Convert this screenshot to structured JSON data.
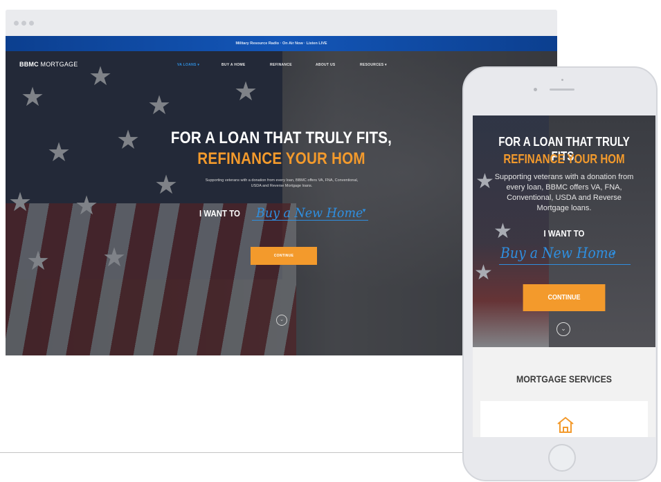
{
  "desktop": {
    "alert_bar": "Military Resource Radio · On Air Now · Listen LIVE",
    "logo": {
      "brand": "BBMC",
      "suffix": "MORTGAGE"
    },
    "nav": [
      {
        "label": "VA LOANS ▾",
        "active": true
      },
      {
        "label": "BUY A HOME",
        "active": false
      },
      {
        "label": "REFINANCE",
        "active": false
      },
      {
        "label": "ABOUT US",
        "active": false
      },
      {
        "label": "RESOURCES ▾",
        "active": false
      }
    ],
    "hero": {
      "title_line1": "FOR A LOAN THAT TRULY FITS,",
      "title_line2": "REFINANCE YOUR HOM",
      "subtitle": "Supporting veterans with a donation from every loan, BBMC offers VA, FNA, Conventional, USDA and Reverse Mortgage loans.",
      "want_label": "I WANT TO",
      "select_value": "Buy a New Home",
      "continue_label": "CONTINUE"
    }
  },
  "mobile": {
    "title_line1": "FOR A LOAN THAT TRULY FITS,",
    "title_line2": "REFINANCE YOUR HOM",
    "subtitle": "Supporting veterans with a donation from every loan, BBMC offers VA, FNA, Conventional, USDA and Reverse Mortgage loans.",
    "want_label": "I WANT TO",
    "select_value": "Buy a New Home",
    "continue_label": "CONTINUE",
    "section_title": "MORTGAGE SERVICES"
  },
  "colors": {
    "accent_orange": "#f39a2c",
    "accent_blue": "#2f8fe0",
    "alert_blue": "#1356b8"
  },
  "icons": {
    "scroll_down": "chevron-down-circle-icon",
    "select_caret": "caret-down-icon",
    "service": "house-icon"
  }
}
